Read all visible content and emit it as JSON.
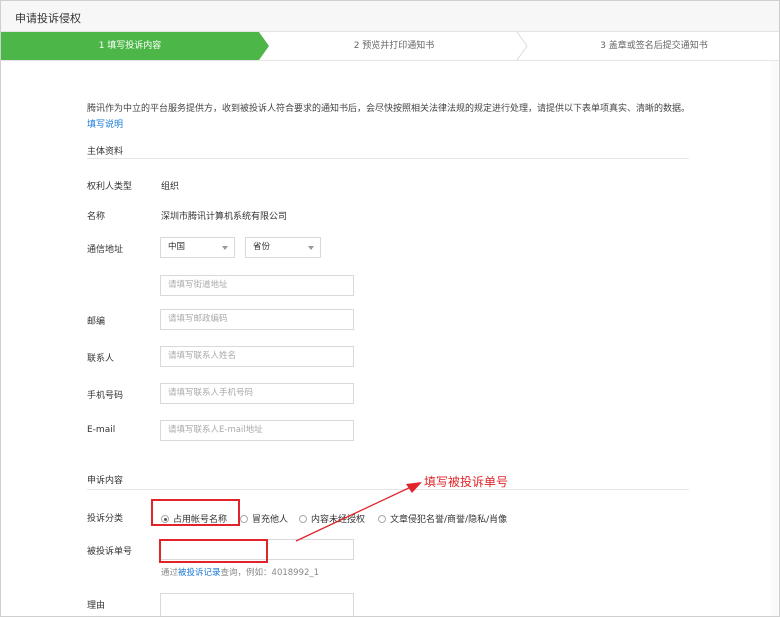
{
  "window": {
    "title": "申请投诉侵权"
  },
  "steps": [
    {
      "label": "1 填写投诉内容"
    },
    {
      "label": "2 预览并打印通知书"
    },
    {
      "label": "3 盖章或签名后提交通知书"
    }
  ],
  "intro": {
    "text": "腾讯作为中立的平台服务提供方，收到被投诉人符合要求的通知书后，会尽快按照相关法律法规的规定进行处理，请提供以下表单项真实、清晰的数据。",
    "link": "填写说明"
  },
  "subject": {
    "section_title": "主体资料",
    "rights_type_label": "权利人类型",
    "rights_type_value": "组织",
    "name_label": "名称",
    "name_value": "深圳市腾讯计算机系统有限公司",
    "address_label": "通信地址",
    "country_value": "中国",
    "province_value": "省份",
    "street_placeholder": "请填写街道地址",
    "postal_label": "邮编",
    "postal_placeholder": "请填写邮政编码",
    "contact_label": "联系人",
    "contact_placeholder": "请填写联系人姓名",
    "phone_label": "手机号码",
    "phone_placeholder": "请填写联系人手机号码",
    "email_label": "E-mail",
    "email_placeholder": "请填写联系人E-mail地址"
  },
  "complaint": {
    "section_title": "申诉内容",
    "category_label": "投诉分类",
    "categories": [
      {
        "label": "占用帐号名称",
        "selected": true
      },
      {
        "label": "冒充他人",
        "selected": false
      },
      {
        "label": "内容未经授权",
        "selected": false
      },
      {
        "label": "文章侵犯名誉/商誉/隐私/肖像",
        "selected": false
      }
    ],
    "number_label": "被投诉单号",
    "hint_prefix": "通过",
    "hint_link": "被投诉记录",
    "hint_suffix": "查询，例如：4018992_1",
    "reason_label": "理由"
  },
  "annotation": {
    "text": "填写被投诉单号"
  },
  "colors": {
    "accent_green": "#4cb748",
    "link_blue": "#1a7ad9",
    "annotation_red": "#e0242a"
  }
}
